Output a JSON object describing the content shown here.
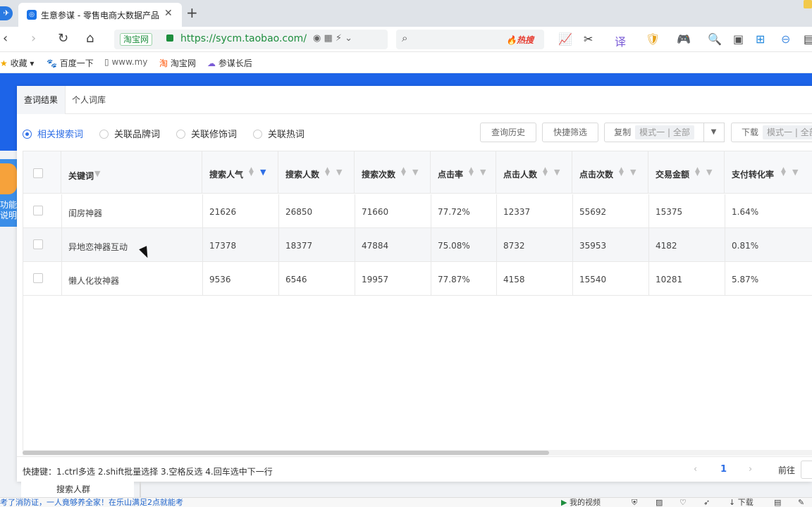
{
  "browser": {
    "tab_title": "生意参谋 - 零售电商大数据产品",
    "tab_close": "✕",
    "new_tab": "+",
    "address_site": "淘宝网",
    "url": "https://sycm.taobao.com/r",
    "search_hot": "🔥热搜",
    "bookmarks": [
      "收藏",
      "百度一下",
      "www.my",
      "淘宝网",
      "参谋长后"
    ]
  },
  "panel": {
    "tabs": [
      "查词结果",
      "个人词库"
    ],
    "radios": [
      {
        "label": "相关搜索词",
        "selected": true
      },
      {
        "label": "关联品牌词",
        "selected": false
      },
      {
        "label": "关联修饰词",
        "selected": false
      },
      {
        "label": "关联热词",
        "selected": false
      }
    ],
    "buttons": {
      "history": "查询历史",
      "quick_filter": "快捷筛选",
      "copy": "复制",
      "copy_mode": "模式一 | 全部",
      "download": "下载",
      "download_mode": "模式一 | 全部"
    }
  },
  "table": {
    "headers": [
      "关键词",
      "搜索人气",
      "搜索人数",
      "搜索次数",
      "点击率",
      "点击人数",
      "点击次数",
      "交易金额",
      "支付转化率"
    ],
    "rows": [
      [
        "闺房神器",
        "21626",
        "26850",
        "71660",
        "77.72%",
        "12337",
        "55692",
        "15375",
        "1.64%"
      ],
      [
        "异地恋神器互动",
        "17378",
        "18377",
        "47884",
        "75.08%",
        "8732",
        "35953",
        "4182",
        "0.81%"
      ],
      [
        "懒人化妆神器",
        "9536",
        "6546",
        "19957",
        "77.87%",
        "4158",
        "15540",
        "10281",
        "5.87%"
      ]
    ]
  },
  "footer": {
    "shortcut": "快捷键：1.ctrl多选 2.shift批量选择 3.空格反选 4.回车选中下一行",
    "page": "1",
    "goto": "前往"
  },
  "sidebar": {
    "help": "功能说明",
    "below_label": "搜索人群"
  },
  "statusbar": {
    "news": "考了消防证，一人竟够养全家！在乐山满足2点就能考",
    "my_video": "我的视频",
    "download": "下载"
  }
}
